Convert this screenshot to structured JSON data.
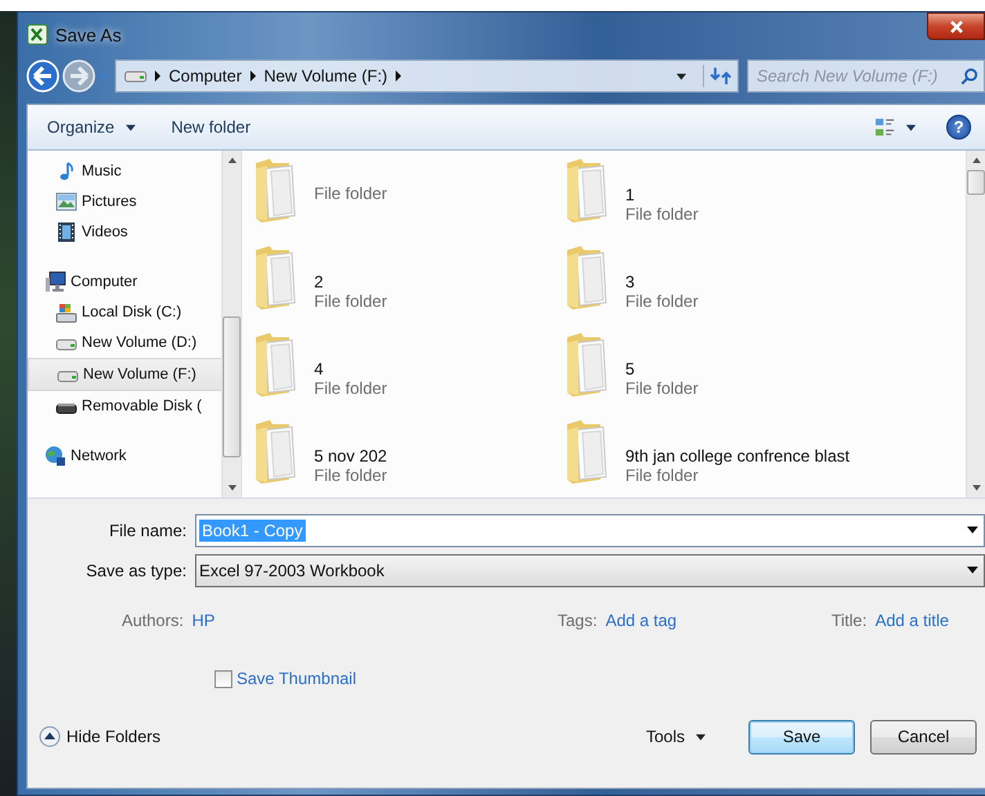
{
  "window": {
    "title": "Save As"
  },
  "address": {
    "path": [
      "Computer",
      "New Volume (F:)"
    ]
  },
  "search": {
    "placeholder": "Search New Volume (F:)"
  },
  "toolbar": {
    "organize": "Organize",
    "new_folder": "New folder",
    "help": "?"
  },
  "sidebar": {
    "library_items": [
      {
        "label": "Music",
        "kind": "music",
        "selected": false
      },
      {
        "label": "Pictures",
        "kind": "pictures",
        "selected": false
      },
      {
        "label": "Videos",
        "kind": "videos",
        "selected": false
      }
    ],
    "tree": [
      {
        "label": "Computer",
        "kind": "computer",
        "selected": false,
        "children": [
          {
            "label": "Local Disk (C:)",
            "kind": "system-drive",
            "selected": false
          },
          {
            "label": "New Volume (D:)",
            "kind": "drive",
            "selected": false
          },
          {
            "label": "New Volume (F:)",
            "kind": "drive",
            "selected": true
          },
          {
            "label": "Removable Disk (",
            "kind": "removable",
            "selected": false
          }
        ]
      },
      {
        "label": "Network",
        "kind": "network",
        "selected": false
      }
    ]
  },
  "files": [
    {
      "type": "File folder"
    },
    {
      "name": "1",
      "type": "File folder"
    },
    {
      "name": "2",
      "type": "File folder"
    },
    {
      "name": "3",
      "type": "File folder"
    },
    {
      "name": "4",
      "type": "File folder"
    },
    {
      "name": "5",
      "type": "File folder"
    },
    {
      "name": "5 nov 202",
      "type": "File folder"
    },
    {
      "name": "9th  jan college confrence blast",
      "type": "File folder"
    }
  ],
  "form": {
    "file_name_label": "File name:",
    "file_name": "Book1 - Copy",
    "file_name_selected": true,
    "save_type_label": "Save as type:",
    "save_type": "Excel 97-2003 Workbook"
  },
  "meta": [
    {
      "label": "Authors:",
      "value": "HP"
    },
    {
      "label": "Tags:",
      "value": "Add a tag"
    },
    {
      "label": "Title:",
      "value": "Add a title"
    }
  ],
  "thumbnail": {
    "label": "Save Thumbnail",
    "checked": false
  },
  "footer": {
    "hide_folders": "Hide Folders",
    "tools": "Tools",
    "save": "Save",
    "cancel": "Cancel"
  }
}
